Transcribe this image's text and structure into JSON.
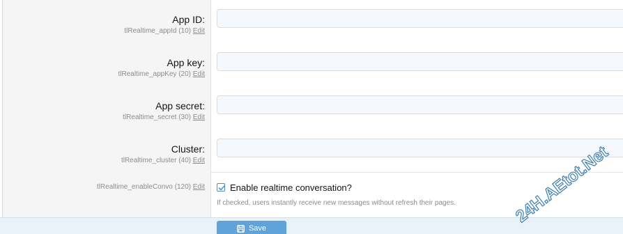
{
  "fields": [
    {
      "label": "App ID:",
      "hint": "tlRealtime_appId (10)",
      "value": ""
    },
    {
      "label": "App key:",
      "hint": "tlRealtime_appKey (20)",
      "value": ""
    },
    {
      "label": "App secret:",
      "hint": "tlRealtime_secret (30)",
      "value": ""
    },
    {
      "label": "Cluster:",
      "hint": "tlRealtime_cluster (40)",
      "value": ""
    }
  ],
  "edit_label": "Edit",
  "enable_convo": {
    "hint": "tlRealtime_enableConvo (120)",
    "label": "Enable realtime conversation?",
    "checked": true,
    "explain": "If checked, users instantly receive new messages without refresh their pages."
  },
  "save_label": "Save",
  "watermark": "24H.AEtot.Net",
  "colors": {
    "accent": "#5fa3db",
    "input_bg": "#f5f9fd",
    "label_col_bg": "#f5f5f5",
    "footer_bg": "#e9f1f9"
  },
  "icons": {
    "checkbox": "checkmark-icon",
    "save": "save-icon"
  }
}
